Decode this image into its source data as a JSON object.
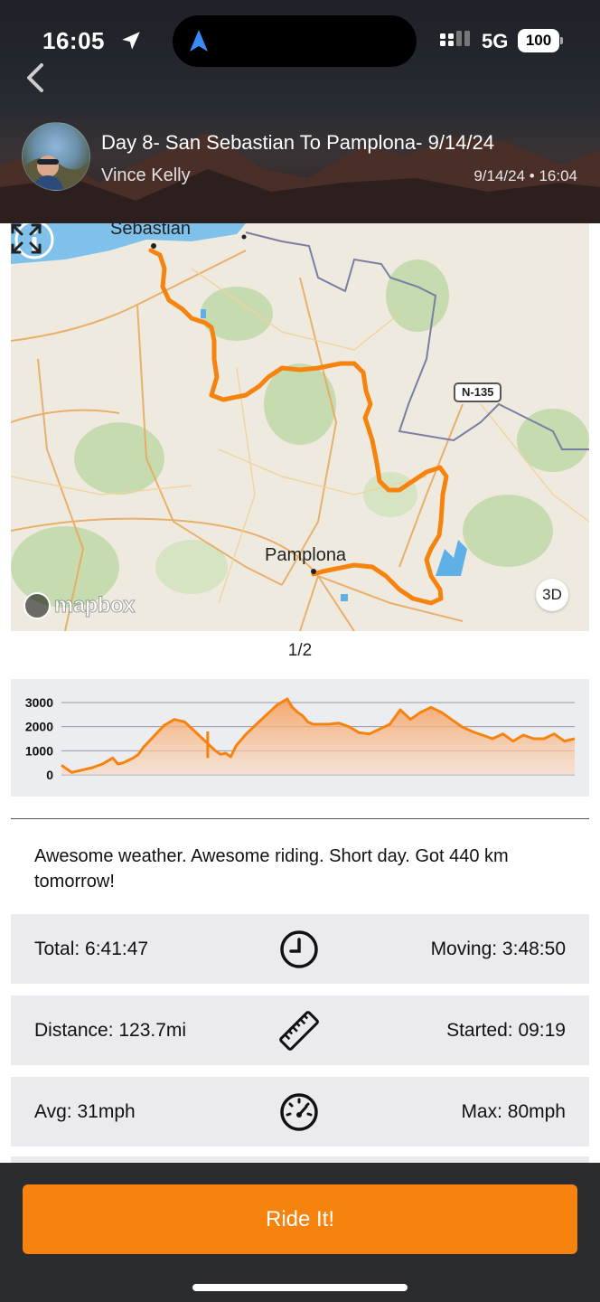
{
  "status_bar": {
    "time": "16:05",
    "network": "5G",
    "battery": "100"
  },
  "header": {
    "title": "Day 8- San Sebastian To Pamplona- 9/14/24",
    "rider": "Vince Kelly",
    "date": "9/14/24 • 16:04"
  },
  "map": {
    "labels": {
      "top_city": "Sebastian",
      "main_city": "Pamplona",
      "road": "N-135"
    },
    "attribution": "mapbox",
    "mode_button": "3D",
    "pager": "1/2",
    "route_color": "#f7830f"
  },
  "elevation": {
    "y_ticks": [
      "3000",
      "2000",
      "1000",
      "0"
    ]
  },
  "chart_data": {
    "type": "area",
    "yticks": [
      0,
      1000,
      2000,
      3000
    ],
    "ylim": [
      0,
      3300
    ],
    "x": [
      0,
      2,
      4,
      6,
      8,
      10,
      11,
      12,
      13,
      14,
      15,
      16,
      18,
      20,
      22,
      24,
      26,
      28,
      30,
      31,
      32,
      33,
      34,
      36,
      38,
      40,
      42,
      44,
      45,
      46,
      47,
      48,
      49,
      50,
      52,
      54,
      56,
      58,
      60,
      62,
      64,
      66,
      68,
      70,
      72,
      74,
      76,
      78,
      80,
      82,
      84,
      86,
      88,
      90,
      92,
      94,
      96,
      98,
      100
    ],
    "y": [
      400,
      100,
      200,
      300,
      450,
      700,
      450,
      500,
      600,
      700,
      850,
      1150,
      1600,
      2050,
      2300,
      2200,
      1800,
      1400,
      1000,
      850,
      900,
      750,
      1200,
      1700,
      2100,
      2500,
      2900,
      3150,
      2800,
      2600,
      2450,
      2200,
      2100,
      2100,
      2100,
      2150,
      2000,
      1750,
      1700,
      1900,
      2100,
      2700,
      2300,
      2600,
      2800,
      2600,
      2300,
      2000,
      1800,
      1650,
      1500,
      1700,
      1400,
      1650,
      1500,
      1500,
      1700,
      1400,
      1500
    ],
    "series": [
      {
        "values": [
          400,
          100,
          200,
          300,
          450,
          700,
          450,
          500,
          600,
          700,
          850,
          1150,
          1600,
          2050,
          2300,
          2200,
          1800,
          1400,
          1000,
          850,
          900,
          750,
          1200,
          1700,
          2100,
          2500,
          2900,
          3150,
          2800,
          2600,
          2450,
          2200,
          2100,
          2100,
          2100,
          2150,
          2000,
          1750,
          1700,
          1900,
          2100,
          2700,
          2300,
          2600,
          2800,
          2600,
          2300,
          2000,
          1800,
          1650,
          1500,
          1700,
          1400,
          1650,
          1500,
          1500,
          1700,
          1400,
          1500
        ]
      }
    ],
    "spike": {
      "x": 28.5,
      "y": 1800
    },
    "grid": true,
    "fill_color": "#f7a86a",
    "line_color": "#f7830f"
  },
  "notes": "Awesome weather.  Awesome riding.  Short day.  Got 440 km tomorrow!",
  "stats": [
    {
      "left": "Total: 6:41:47",
      "right": "Moving: 3:48:50",
      "icon": "clock-icon"
    },
    {
      "left": "Distance: 123.7mi",
      "right": "Started: 09:19",
      "icon": "ruler-icon"
    },
    {
      "left": "Avg: 31mph",
      "right": "Max: 80mph",
      "icon": "speedometer-icon"
    }
  ],
  "action": {
    "ride_it": "Ride It!"
  }
}
